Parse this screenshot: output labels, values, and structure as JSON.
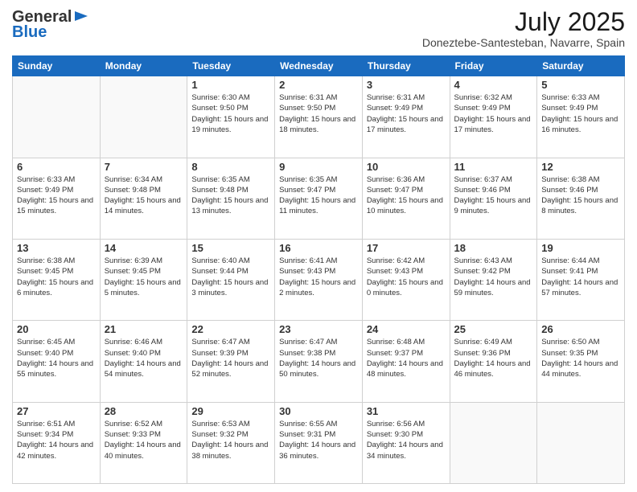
{
  "header": {
    "logo_general": "General",
    "logo_blue": "Blue",
    "month_year": "July 2025",
    "location": "Doneztebe-Santesteban, Navarre, Spain"
  },
  "weekdays": [
    "Sunday",
    "Monday",
    "Tuesday",
    "Wednesday",
    "Thursday",
    "Friday",
    "Saturday"
  ],
  "weeks": [
    [
      {
        "day": "",
        "info": ""
      },
      {
        "day": "",
        "info": ""
      },
      {
        "day": "1",
        "info": "Sunrise: 6:30 AM\nSunset: 9:50 PM\nDaylight: 15 hours and 19 minutes."
      },
      {
        "day": "2",
        "info": "Sunrise: 6:31 AM\nSunset: 9:50 PM\nDaylight: 15 hours and 18 minutes."
      },
      {
        "day": "3",
        "info": "Sunrise: 6:31 AM\nSunset: 9:49 PM\nDaylight: 15 hours and 17 minutes."
      },
      {
        "day": "4",
        "info": "Sunrise: 6:32 AM\nSunset: 9:49 PM\nDaylight: 15 hours and 17 minutes."
      },
      {
        "day": "5",
        "info": "Sunrise: 6:33 AM\nSunset: 9:49 PM\nDaylight: 15 hours and 16 minutes."
      }
    ],
    [
      {
        "day": "6",
        "info": "Sunrise: 6:33 AM\nSunset: 9:49 PM\nDaylight: 15 hours and 15 minutes."
      },
      {
        "day": "7",
        "info": "Sunrise: 6:34 AM\nSunset: 9:48 PM\nDaylight: 15 hours and 14 minutes."
      },
      {
        "day": "8",
        "info": "Sunrise: 6:35 AM\nSunset: 9:48 PM\nDaylight: 15 hours and 13 minutes."
      },
      {
        "day": "9",
        "info": "Sunrise: 6:35 AM\nSunset: 9:47 PM\nDaylight: 15 hours and 11 minutes."
      },
      {
        "day": "10",
        "info": "Sunrise: 6:36 AM\nSunset: 9:47 PM\nDaylight: 15 hours and 10 minutes."
      },
      {
        "day": "11",
        "info": "Sunrise: 6:37 AM\nSunset: 9:46 PM\nDaylight: 15 hours and 9 minutes."
      },
      {
        "day": "12",
        "info": "Sunrise: 6:38 AM\nSunset: 9:46 PM\nDaylight: 15 hours and 8 minutes."
      }
    ],
    [
      {
        "day": "13",
        "info": "Sunrise: 6:38 AM\nSunset: 9:45 PM\nDaylight: 15 hours and 6 minutes."
      },
      {
        "day": "14",
        "info": "Sunrise: 6:39 AM\nSunset: 9:45 PM\nDaylight: 15 hours and 5 minutes."
      },
      {
        "day": "15",
        "info": "Sunrise: 6:40 AM\nSunset: 9:44 PM\nDaylight: 15 hours and 3 minutes."
      },
      {
        "day": "16",
        "info": "Sunrise: 6:41 AM\nSunset: 9:43 PM\nDaylight: 15 hours and 2 minutes."
      },
      {
        "day": "17",
        "info": "Sunrise: 6:42 AM\nSunset: 9:43 PM\nDaylight: 15 hours and 0 minutes."
      },
      {
        "day": "18",
        "info": "Sunrise: 6:43 AM\nSunset: 9:42 PM\nDaylight: 14 hours and 59 minutes."
      },
      {
        "day": "19",
        "info": "Sunrise: 6:44 AM\nSunset: 9:41 PM\nDaylight: 14 hours and 57 minutes."
      }
    ],
    [
      {
        "day": "20",
        "info": "Sunrise: 6:45 AM\nSunset: 9:40 PM\nDaylight: 14 hours and 55 minutes."
      },
      {
        "day": "21",
        "info": "Sunrise: 6:46 AM\nSunset: 9:40 PM\nDaylight: 14 hours and 54 minutes."
      },
      {
        "day": "22",
        "info": "Sunrise: 6:47 AM\nSunset: 9:39 PM\nDaylight: 14 hours and 52 minutes."
      },
      {
        "day": "23",
        "info": "Sunrise: 6:47 AM\nSunset: 9:38 PM\nDaylight: 14 hours and 50 minutes."
      },
      {
        "day": "24",
        "info": "Sunrise: 6:48 AM\nSunset: 9:37 PM\nDaylight: 14 hours and 48 minutes."
      },
      {
        "day": "25",
        "info": "Sunrise: 6:49 AM\nSunset: 9:36 PM\nDaylight: 14 hours and 46 minutes."
      },
      {
        "day": "26",
        "info": "Sunrise: 6:50 AM\nSunset: 9:35 PM\nDaylight: 14 hours and 44 minutes."
      }
    ],
    [
      {
        "day": "27",
        "info": "Sunrise: 6:51 AM\nSunset: 9:34 PM\nDaylight: 14 hours and 42 minutes."
      },
      {
        "day": "28",
        "info": "Sunrise: 6:52 AM\nSunset: 9:33 PM\nDaylight: 14 hours and 40 minutes."
      },
      {
        "day": "29",
        "info": "Sunrise: 6:53 AM\nSunset: 9:32 PM\nDaylight: 14 hours and 38 minutes."
      },
      {
        "day": "30",
        "info": "Sunrise: 6:55 AM\nSunset: 9:31 PM\nDaylight: 14 hours and 36 minutes."
      },
      {
        "day": "31",
        "info": "Sunrise: 6:56 AM\nSunset: 9:30 PM\nDaylight: 14 hours and 34 minutes."
      },
      {
        "day": "",
        "info": ""
      },
      {
        "day": "",
        "info": ""
      }
    ]
  ]
}
